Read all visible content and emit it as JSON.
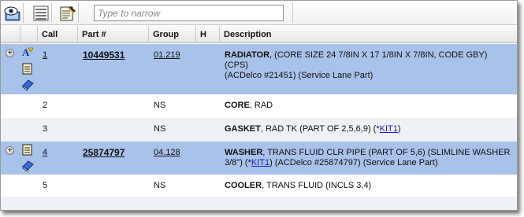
{
  "toolbar": {
    "icons": [
      "view-eye-icon",
      "list-icon",
      "edit-notes-icon"
    ],
    "search_placeholder": "Type to narrow"
  },
  "columns": [
    "Call",
    "Part #",
    "Group",
    "H",
    "Description"
  ],
  "rows": [
    {
      "call": "1",
      "part": "10449531",
      "group": "01.219",
      "h": "",
      "name": "RADIATOR",
      "desc_line1": ",  (CORE SIZE 24 7/8IN X 17 1/8IN X 7/8IN, CODE GBY) (CPS)",
      "desc_line2": "(ACDelco #21451)  (Service Lane Part)",
      "selected": true
    },
    {
      "call": "2",
      "part": "",
      "group": "NS",
      "h": "",
      "name": "CORE",
      "desc_line1": ", RAD"
    },
    {
      "call": "3",
      "part": "",
      "group": "NS",
      "h": "",
      "name": "GASKET",
      "desc_line1": ", RAD TK (PART OF 2,5,6,9) (",
      "kit_prefix": "*",
      "kit": "KIT1",
      "desc_tail": ")"
    },
    {
      "call": "4",
      "part": "25874797",
      "group": "04.128",
      "h": "",
      "name": "WASHER",
      "desc_line1": ", TRANS FLUID CLR PIPE (PART OF 5,6) (SLIMLINE WASHER",
      "desc_line2_pre": "3/8\") (",
      "kit_prefix": "*",
      "kit": "KIT1",
      "desc_line2_post": ") (ACDelco #25874797)  (Service Lane Part)",
      "selected": true
    },
    {
      "call": "5",
      "part": "",
      "group": "NS",
      "h": "",
      "name": "COOLER",
      "desc_line1": ", TRANS FLUID (INCLS 3,4)"
    }
  ]
}
